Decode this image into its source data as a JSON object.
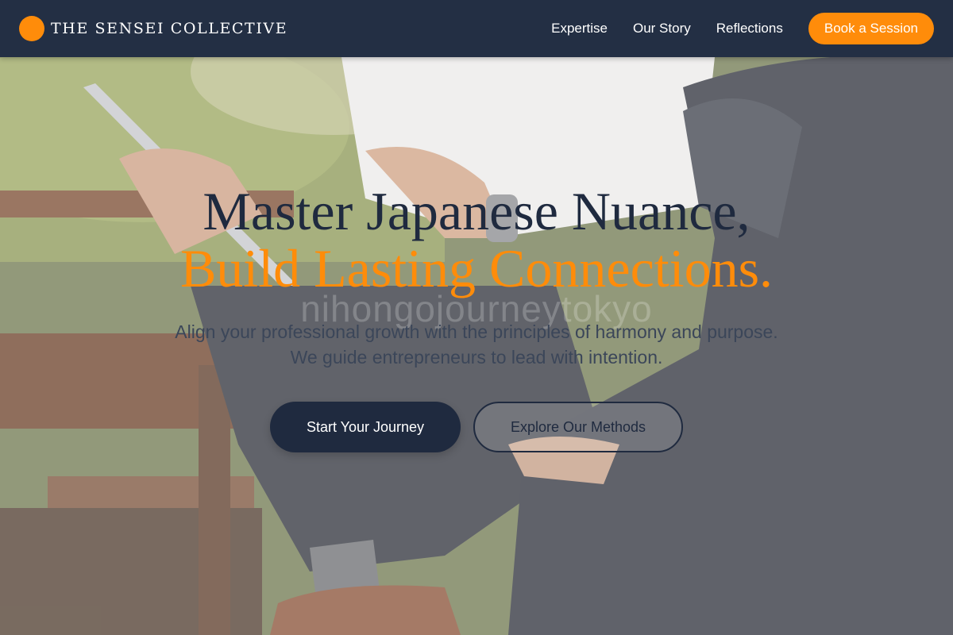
{
  "brand": {
    "name": "THE SENSEI COLLECTIVE",
    "mark_color": "#ff8c0a"
  },
  "nav": {
    "links": [
      {
        "label": "Expertise"
      },
      {
        "label": "Our Story"
      },
      {
        "label": "Reflections"
      }
    ],
    "cta_label": "Book a Session"
  },
  "hero": {
    "headline_line1": "Master Japanese Nuance,",
    "headline_line2": "Build Lasting Connections.",
    "watermark": "nihongojourneytokyo",
    "subtitle": "Align your professional growth with the principles of harmony and purpose. We guide entrepreneurs to lead with intention.",
    "primary_cta": "Start Your Journey",
    "secondary_cta": "Explore Our Methods"
  },
  "colors": {
    "nav_bg": "#232f44",
    "accent": "#ff8c0a",
    "dark_text": "#1f2a3f"
  }
}
